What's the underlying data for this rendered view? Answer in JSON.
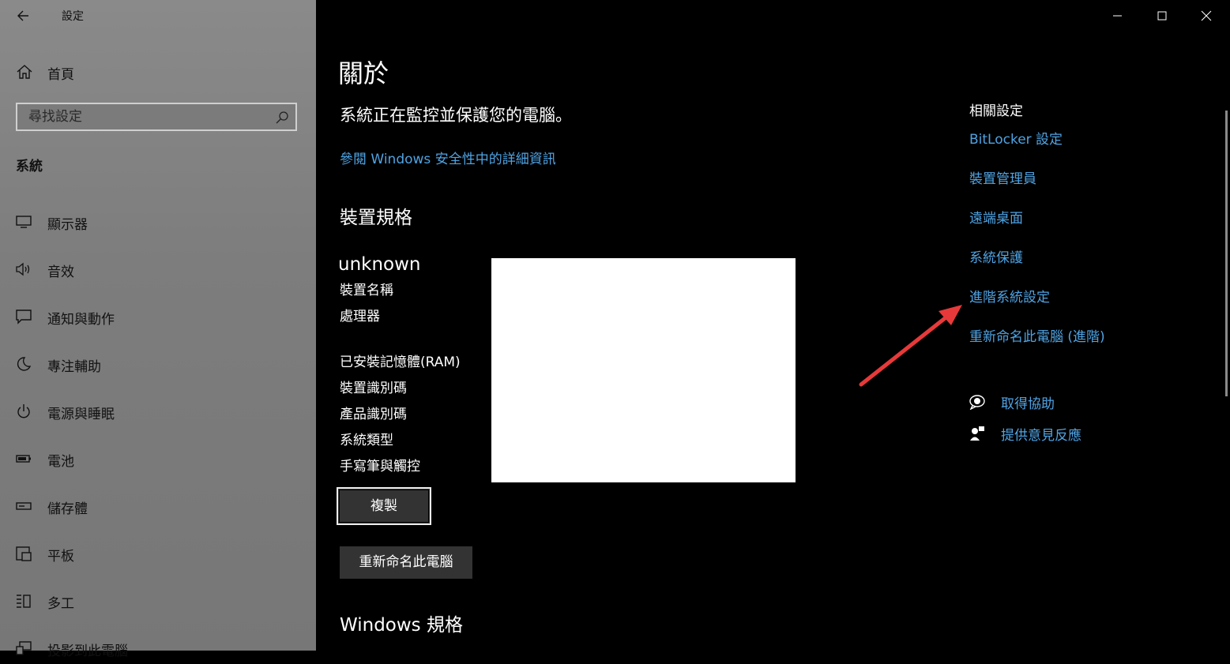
{
  "window": {
    "app_title": "設定",
    "controls": [
      "minimize-icon",
      "maximize-icon",
      "close-icon"
    ]
  },
  "sidebar": {
    "home_label": "首頁",
    "search_placeholder": "尋找設定",
    "section_label": "系統",
    "items": [
      {
        "label": "顯示器",
        "icon": "display-icon"
      },
      {
        "label": "音效",
        "icon": "sound-icon"
      },
      {
        "label": "通知與動作",
        "icon": "notification-icon"
      },
      {
        "label": "專注輔助",
        "icon": "moon-icon"
      },
      {
        "label": "電源與睡眠",
        "icon": "power-icon"
      },
      {
        "label": "電池",
        "icon": "battery-icon"
      },
      {
        "label": "儲存體",
        "icon": "storage-icon"
      },
      {
        "label": "平板",
        "icon": "tablet-icon"
      },
      {
        "label": "多工",
        "icon": "multitask-icon"
      },
      {
        "label": "投影到此電腦",
        "icon": "project-icon"
      }
    ]
  },
  "main": {
    "title": "關於",
    "status_text": "系統正在監控並保護您的電腦。",
    "security_link": "參閱 Windows 安全性中的詳細資訊",
    "device_specs_heading": "裝置規格",
    "device_name": "unknown",
    "spec_labels": [
      "裝置名稱",
      "處理器",
      "已安裝記憶體(RAM)",
      "裝置識別碼",
      "產品識別碼",
      "系統類型",
      "手寫筆與觸控"
    ],
    "copy_button": "複製",
    "rename_button": "重新命名此電腦",
    "windows_specs_heading": "Windows 規格"
  },
  "related": {
    "heading": "相關設定",
    "links": [
      "BitLocker 設定",
      "裝置管理員",
      "遠端桌面",
      "系統保護",
      "進階系統設定",
      "重新命名此電腦 (進階)"
    ],
    "help": [
      {
        "label": "取得協助",
        "icon": "help-chat-icon"
      },
      {
        "label": "提供意見反應",
        "icon": "feedback-icon"
      }
    ]
  },
  "colors": {
    "accent_link": "#4fa3e3",
    "annotation_arrow": "#e8393a"
  }
}
